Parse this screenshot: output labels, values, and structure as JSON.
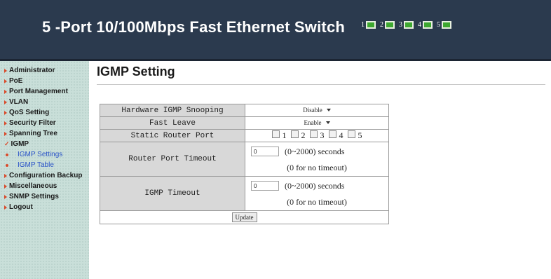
{
  "header": {
    "title": "5 -Port 10/100Mbps  Fast Ethernet Switch",
    "ports": [
      "1",
      "2",
      "3",
      "4",
      "5"
    ],
    "port_led_color": "#3ea830"
  },
  "sidebar": {
    "items": [
      {
        "label": "Administrator"
      },
      {
        "label": "PoE"
      },
      {
        "label": "Port Management"
      },
      {
        "label": "VLAN"
      },
      {
        "label": "QoS Setting"
      },
      {
        "label": "Security Filter"
      },
      {
        "label": "Spanning Tree"
      },
      {
        "label": "IGMP",
        "expanded": true
      },
      {
        "label": "IGMP Settings",
        "sub": true,
        "selected": true
      },
      {
        "label": "IGMP Table",
        "sub": true
      },
      {
        "label": "Configuration Backup"
      },
      {
        "label": "Miscellaneous"
      },
      {
        "label": "SNMP Settings"
      },
      {
        "label": "Logout"
      }
    ]
  },
  "page": {
    "title": "IGMP Setting"
  },
  "form": {
    "hardware_snooping": {
      "label": "Hardware IGMP Snooping",
      "value": "Disable"
    },
    "fast_leave": {
      "label": "Fast Leave",
      "value": "Enable"
    },
    "static_router_port": {
      "label": "Static Router Port",
      "ports": [
        "1",
        "2",
        "3",
        "4",
        "5"
      ]
    },
    "router_port_timeout": {
      "label": "Router Port Timeout",
      "value": "0",
      "range": "(0~2000) seconds",
      "note": "(0 for no timeout)"
    },
    "igmp_timeout": {
      "label": "IGMP Timeout",
      "value": "0",
      "range": "(0~2000) seconds",
      "note": "(0 for no timeout)"
    },
    "update_label": "Update"
  }
}
